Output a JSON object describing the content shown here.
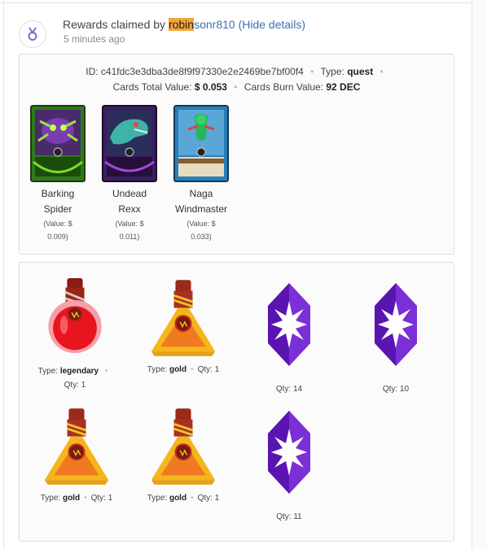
{
  "header": {
    "prefix": "Rewards claimed by ",
    "user_highlight": "robin",
    "user_rest": "sonr810",
    "hide_details": "(Hide details)",
    "time": "5 minutes ago"
  },
  "summary": {
    "id_label": "ID: ",
    "id_value": "c41fdc3e3dba3de8f9f97330e2e2469be7bf00f4",
    "type_label": "Type: ",
    "type_value": "quest",
    "cards_total_label": "Cards Total Value: ",
    "cards_total_value": "$ 0.053",
    "burn_label": "Cards Burn Value: ",
    "burn_value": "92 DEC"
  },
  "cards": [
    {
      "name_line1": "Barking",
      "name_line2": "Spider",
      "value_line1": "(Value: $",
      "value_line2": "0.009)"
    },
    {
      "name_line1": "Undead Rexx",
      "name_line2": "",
      "value_line1": "(Value: $",
      "value_line2": "0.011)"
    },
    {
      "name_line1": "Naga",
      "name_line2": "Windmaster",
      "value_line1": "(Value: $",
      "value_line2": "0.033)"
    }
  ],
  "rewards": [
    {
      "icon": "legendary-potion-icon",
      "type_label": "Type: ",
      "type": "legendary",
      "qty_label": "Qty: ",
      "qty": "1"
    },
    {
      "icon": "gold-potion-icon",
      "type_label": "Type: ",
      "type": "gold",
      "qty_label": "Qty: ",
      "qty": "1"
    },
    {
      "icon": "purple-crystal-icon",
      "qty_label": "Qty: ",
      "qty": "14"
    },
    {
      "icon": "purple-crystal-icon",
      "qty_label": "Qty: ",
      "qty": "10"
    },
    {
      "icon": "gold-potion-icon",
      "type_label": "Type: ",
      "type": "gold",
      "qty_label": "Qty: ",
      "qty": "1"
    },
    {
      "icon": "gold-potion-icon",
      "type_label": "Type: ",
      "type": "gold",
      "qty_label": "Qty: ",
      "qty": "1"
    },
    {
      "icon": "purple-crystal-icon",
      "qty_label": "Qty: ",
      "qty": "11"
    }
  ],
  "colors": {
    "link": "#3b6fb6",
    "highlight": "#f5a53b",
    "crystal": "#6a1fc4",
    "potion_red": "#e8141e",
    "potion_gold": "#f6b21c"
  }
}
